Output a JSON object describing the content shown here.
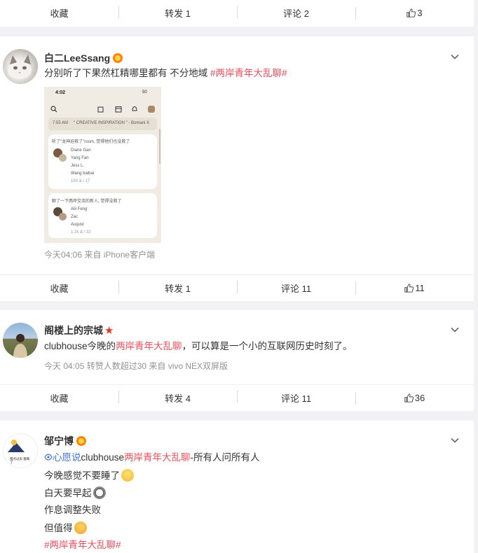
{
  "post0": {
    "actions": {
      "collect": "收藏",
      "forward": "转发 1",
      "comment": "评论 2",
      "like": "3"
    }
  },
  "post1": {
    "user": "白二LeeSsang",
    "text_plain": "分别听了下果然杠精哪里都有 不分地域 ",
    "tag": "#两岸青年大乱聊#",
    "screenshot": {
      "time": "4:02",
      "battery": "50",
      "quote": "\" CREATIVE INSPIRATION \" - Bomani X",
      "quote_time": "7:55 AM",
      "room1_title": "听了\"龙神迫救了\"room, 觉得他们也没救了",
      "room1_names": [
        "Diane Gan",
        "Yang Fan",
        "Jess L.",
        "Wang baibai"
      ],
      "room1_stats": "150 & / 17",
      "room2_title": "聊了一下两岸交流的新人, 觉得没救了",
      "room2_names": [
        "Aili Feng",
        "Zac",
        "August"
      ],
      "room2_stats": "1.2k & / 32"
    },
    "meta": "今天04:06  来自 iPhone客户端",
    "actions": {
      "collect": "收藏",
      "forward": "转发 1",
      "comment": "评论 11",
      "like": "11"
    }
  },
  "post2": {
    "user": "阁楼上的宗城",
    "text_before": "clubhouse今晚的",
    "tag": "两岸青年大乱聊",
    "text_after": "，可以算是一个小的互联网历史时刻了。",
    "meta": "今天 04:05 转赞人数超过30  来自 vivo NEX双屏版",
    "actions": {
      "collect": "收藏",
      "forward": "转发 4",
      "comment": "评论 11",
      "like": "36"
    }
  },
  "post3": {
    "user": "邹宁博",
    "avatar_text": "慢点过去 都来了",
    "link": "心愿说",
    "line1_mid": "clubhouse",
    "line1_tag": "两岸青年大乱聊",
    "line1_end": "-所有人问所有人",
    "line2": "今晚感觉不要睡了",
    "line3": "白天要早起",
    "line4": "作息调整失败",
    "line5": "但值得",
    "line6": "#两岸青年大乱聊#"
  },
  "colors": {
    "tag": "#e64f5d",
    "link": "#4775d6",
    "vip": "#ff8200"
  }
}
